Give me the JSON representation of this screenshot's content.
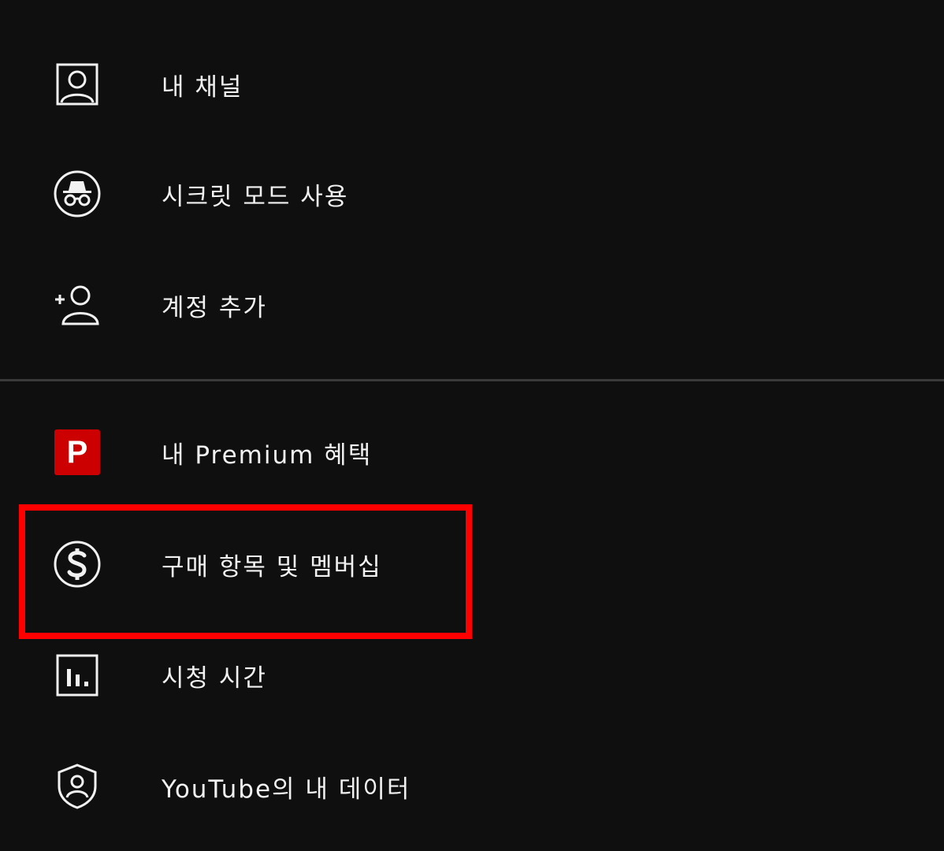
{
  "menu": {
    "section1": [
      {
        "label": "내 채널",
        "icon": "account-box-icon"
      },
      {
        "label": "시크릿 모드 사용",
        "icon": "incognito-icon"
      },
      {
        "label": "계정 추가",
        "icon": "add-account-icon"
      }
    ],
    "section2": [
      {
        "label": "내 Premium 혜택",
        "icon": "premium-p-icon",
        "badge_text": "P"
      },
      {
        "label": "구매 항목 및 멤버십",
        "icon": "dollar-circle-icon"
      },
      {
        "label": "시청 시간",
        "icon": "bar-chart-icon"
      },
      {
        "label": "YouTube의 내 데이터",
        "icon": "shield-person-icon"
      }
    ]
  },
  "colors": {
    "background": "#0f0f0f",
    "text": "#f1f1f1",
    "premium_badge": "#cc0000",
    "highlight": "#ff0000",
    "divider": "#3a3a3a"
  }
}
